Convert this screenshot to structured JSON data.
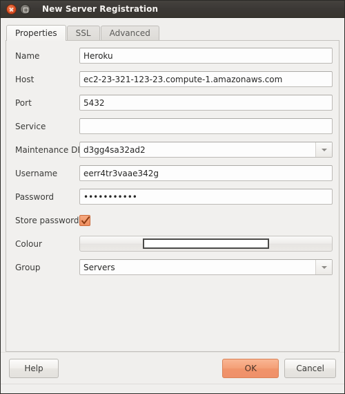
{
  "window": {
    "title": "New Server Registration",
    "close_icon": "close-icon",
    "maximize_icon": "maximize-icon"
  },
  "tabs": [
    {
      "label": "Properties",
      "active": true
    },
    {
      "label": "SSL",
      "active": false
    },
    {
      "label": "Advanced",
      "active": false
    }
  ],
  "form": {
    "name": {
      "label": "Name",
      "value": "Heroku",
      "placeholder": ""
    },
    "host": {
      "label": "Host",
      "value": "ec2-23-321-123-23.compute-1.amazonaws.com",
      "placeholder": ""
    },
    "port": {
      "label": "Port",
      "value": "5432",
      "placeholder": ""
    },
    "service": {
      "label": "Service",
      "value": "",
      "placeholder": ""
    },
    "maintenance_db": {
      "label": "Maintenance DB",
      "value": "d3gg4sa32ad2"
    },
    "username": {
      "label": "Username",
      "value": "eerr4tr3vaae342g",
      "placeholder": ""
    },
    "password": {
      "label": "Password",
      "value": "•••••••••••",
      "placeholder": ""
    },
    "store_password": {
      "label": "Store password",
      "checked": true,
      "icon": "check-icon"
    },
    "colour": {
      "label": "Colour",
      "swatch_colour": "#ffffff"
    },
    "group": {
      "label": "Group",
      "value": "Servers"
    }
  },
  "footer": {
    "help_label": "Help",
    "ok_label": "OK",
    "cancel_label": "Cancel"
  },
  "colors": {
    "accent": "#ef9168",
    "titlebar": "#3b3835",
    "panel": "#f1f0ee",
    "close_button": "#dc5026"
  }
}
